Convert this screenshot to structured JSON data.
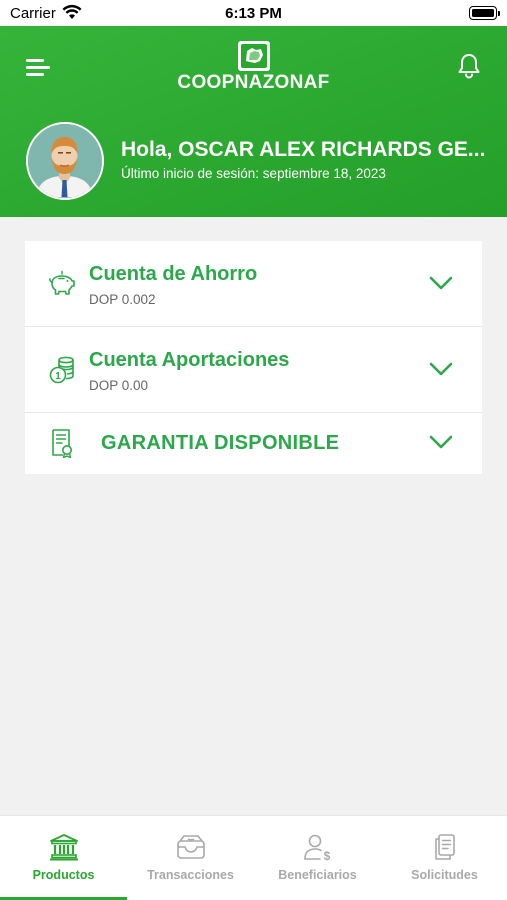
{
  "status_bar": {
    "carrier": "Carrier",
    "time": "6:13 PM"
  },
  "header": {
    "brand": "COOPNAZONAF",
    "greeting": "Hola, OSCAR ALEX RICHARDS GE...",
    "last_login": "Último inicio de sesión: septiembre 18, 2023",
    "background_color": "#2aa72f"
  },
  "products": {
    "items": [
      {
        "title": "Cuenta de Ahorro",
        "amount": "DOP 0.002",
        "icon": "piggy-bank-icon"
      },
      {
        "title": "Cuenta Aportaciones",
        "amount": "DOP 0.00",
        "icon": "coins-icon"
      },
      {
        "title": "GARANTIA DISPONIBLE",
        "icon": "certificate-icon"
      }
    ],
    "accent_color": "#2ba84a"
  },
  "tabbar": {
    "tabs": [
      {
        "label": "Productos",
        "icon": "bank-icon",
        "active": true
      },
      {
        "label": "Transacciones",
        "icon": "wallet-icon",
        "active": false
      },
      {
        "label": "Beneficiarios",
        "icon": "user-dollar-icon",
        "active": false
      },
      {
        "label": "Solicitudes",
        "icon": "documents-icon",
        "active": false
      }
    ]
  }
}
